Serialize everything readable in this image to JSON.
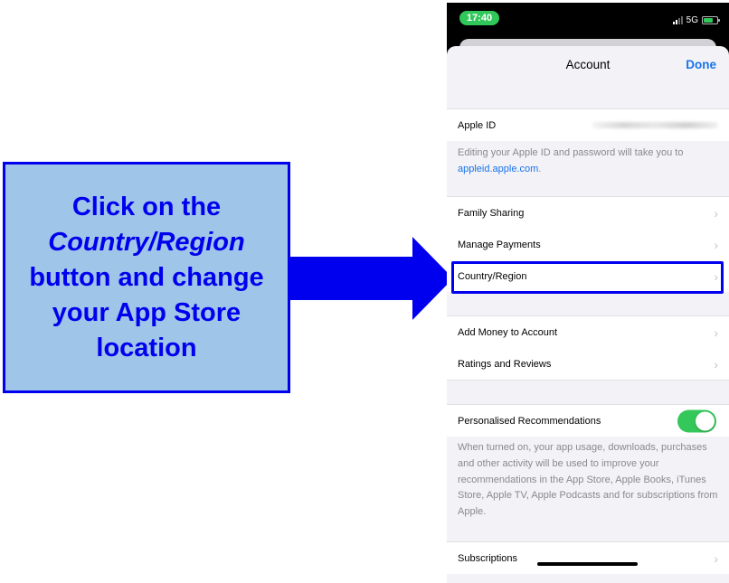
{
  "callout": {
    "line1": "Click on the",
    "line2_italic": "Country/Region",
    "line3": "button and change",
    "line4": "your App Store",
    "line5": "location",
    "accent_color": "#0000ee",
    "background_color": "#9fc5e8"
  },
  "status_bar": {
    "time": "17:40",
    "network": "5G",
    "icons": [
      "signal-icon",
      "battery-charging-icon"
    ]
  },
  "navbar": {
    "title": "Account",
    "done_label": "Done"
  },
  "apple_id": {
    "label": "Apple ID",
    "value_redacted": true
  },
  "apple_id_note": {
    "text": "Editing your Apple ID and password will take you to",
    "link": "appleid.apple.com",
    "suffix": "."
  },
  "group1": [
    {
      "label": "Family Sharing"
    },
    {
      "label": "Manage Payments"
    },
    {
      "label": "Country/Region",
      "highlighted": true
    }
  ],
  "group2": [
    {
      "label": "Add Money to Account"
    },
    {
      "label": "Ratings and Reviews"
    }
  ],
  "personalised": {
    "label": "Personalised Recommendations",
    "enabled": true,
    "note": "When turned on, your app usage, downloads, purchases and other activity will be used to improve your recommendations in the App Store, Apple Books, iTunes Store, Apple TV, Apple Podcasts and for subscriptions from Apple."
  },
  "subscriptions": {
    "label": "Subscriptions"
  },
  "chevron": "›"
}
